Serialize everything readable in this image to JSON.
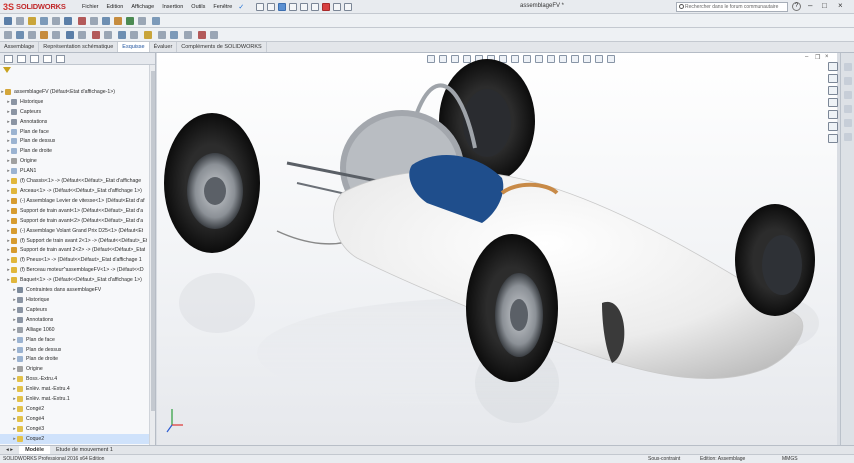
{
  "app": {
    "logo_mark": "3S",
    "logo_text": "SOLIDWORKS",
    "doc_title": "assemblageFV *",
    "menu": [
      "Fichier",
      "Edition",
      "Affichage",
      "Insertion",
      "Outils",
      "Fenêtre"
    ],
    "search_placeholder": "Rechercher dans le forum communautaire",
    "help": "?"
  },
  "command_tabs": [
    "Assemblage",
    "Représentation schématique",
    "Esquisse",
    "Évaluer",
    "Compléments de SOLIDWORKS"
  ],
  "active_command_tab": "Esquisse",
  "tree": [
    {
      "label": "assemblageFV  (Défaut<Etat d'affichage-1>)",
      "indent": 0,
      "icon": "assembly-icon"
    },
    {
      "label": "Historique",
      "indent": 1,
      "icon": "history-icon"
    },
    {
      "label": "Capteurs",
      "indent": 1,
      "icon": "sensor-icon"
    },
    {
      "label": "Annotations",
      "indent": 1,
      "icon": "annotation-icon"
    },
    {
      "label": "Plan de face",
      "indent": 1,
      "icon": "plane-icon"
    },
    {
      "label": "Plan de dessus",
      "indent": 1,
      "icon": "plane-icon"
    },
    {
      "label": "Plan de droite",
      "indent": 1,
      "icon": "plane-icon"
    },
    {
      "label": "Origine",
      "indent": 1,
      "icon": "origin-icon"
    },
    {
      "label": "PLAN1",
      "indent": 1,
      "icon": "plane-icon"
    },
    {
      "label": "(f) Chassis<1> -> (Défaut<<Défaut>_Etat d'affichage",
      "indent": 1,
      "icon": "part-icon"
    },
    {
      "label": "Arceau<1> -> (Défaut<<Défaut>_Etat d'affichage 1>)",
      "indent": 1,
      "icon": "part-icon"
    },
    {
      "label": "(-) Assemblage Levier de vitesse<1> (Défaut<Etat d'af",
      "indent": 1,
      "icon": "subassembly-icon"
    },
    {
      "label": "Support de train avant<1> (Défaut<<Défaut>_Etat d'a",
      "indent": 1,
      "icon": "subassembly-icon"
    },
    {
      "label": "Support de train avant<2> (Défaut<<Défaut>_Etat d'a",
      "indent": 1,
      "icon": "subassembly-icon"
    },
    {
      "label": "(-) Assemblage Volant Grand Prix D25<1> (Défaut<Et",
      "indent": 1,
      "icon": "subassembly-icon"
    },
    {
      "label": "(f) Support de train avant 2<1> -> (Défaut<<Défaut>_Et",
      "indent": 1,
      "icon": "subassembly-icon"
    },
    {
      "label": "Support de train avant 2<2> -> (Défaut<<Défaut>_Etat",
      "indent": 1,
      "icon": "subassembly-icon"
    },
    {
      "label": "(f) Pneus<1> -> (Défaut<<Défaut>_Etat d'affichage 1",
      "indent": 1,
      "icon": "part-icon"
    },
    {
      "label": "(f) Berceau moteur^assemblageFV<1> -> (Défaut<<D",
      "indent": 1,
      "icon": "part-icon"
    },
    {
      "label": "Baquet<1> -> (Défaut<<Défaut>_Etat d'affichage 1>)",
      "indent": 1,
      "icon": "part-icon"
    },
    {
      "label": "Contraintes dans assemblageFV",
      "indent": 2,
      "icon": "mate-icon"
    },
    {
      "label": "Historique",
      "indent": 2,
      "icon": "history-icon"
    },
    {
      "label": "Capteurs",
      "indent": 2,
      "icon": "sensor-icon"
    },
    {
      "label": "Annotations",
      "indent": 2,
      "icon": "annotation-icon"
    },
    {
      "label": "Alliage 1060",
      "indent": 2,
      "icon": "material-icon"
    },
    {
      "label": "Plan de face",
      "indent": 2,
      "icon": "plane-icon"
    },
    {
      "label": "Plan de dessus",
      "indent": 2,
      "icon": "plane-icon"
    },
    {
      "label": "Plan de droite",
      "indent": 2,
      "icon": "plane-icon"
    },
    {
      "label": "Origine",
      "indent": 2,
      "icon": "origin-icon"
    },
    {
      "label": "Boss.-Extru.4",
      "indent": 2,
      "icon": "feature-icon"
    },
    {
      "label": "Enlèv. mat.-Extru.4",
      "indent": 2,
      "icon": "feature-icon"
    },
    {
      "label": "Enlèv. mat.-Extru.1",
      "indent": 2,
      "icon": "feature-icon"
    },
    {
      "label": "Congé2",
      "indent": 2,
      "icon": "fillet-icon"
    },
    {
      "label": "Congé4",
      "indent": 2,
      "icon": "fillet-icon"
    },
    {
      "label": "Congé3",
      "indent": 2,
      "icon": "fillet-icon"
    },
    {
      "label": "Coque2",
      "indent": 2,
      "icon": "shell-icon"
    }
  ],
  "bottom_tabs": [
    "Modèle",
    "Etude de mouvement 1"
  ],
  "active_bottom_tab": "Modèle",
  "status": {
    "edition": "SOLIDWORKS Professional 2016 x64 Edition",
    "constraint": "Sous-contraint",
    "editing": "Edition: Assemblage",
    "units": "MMGS"
  },
  "colors": {
    "accent": "#1a4f9c",
    "brand": "#c0282a",
    "body_white": "#f2f2f2",
    "seat_blue": "#1f4e8c",
    "tire": "#1a1a1a"
  }
}
